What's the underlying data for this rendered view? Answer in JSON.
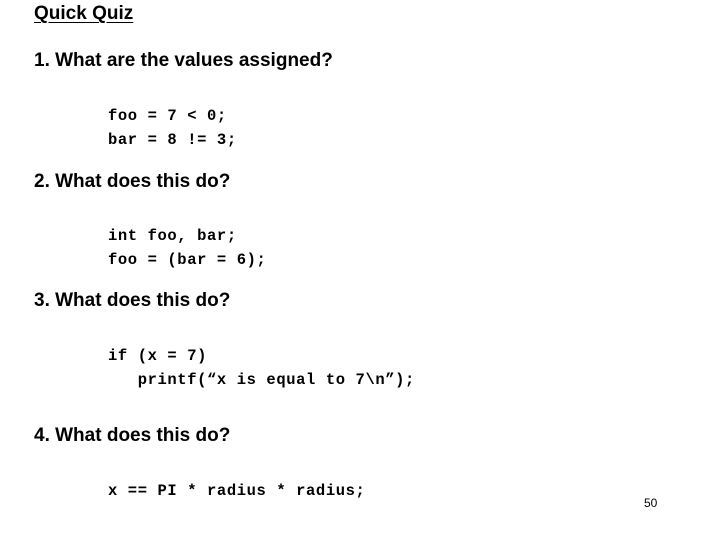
{
  "slide": {
    "title": "Quick Quiz",
    "page_number": "50",
    "background_color": "#ffffff",
    "text_color": "#000000"
  },
  "questions": [
    {
      "heading": "1. What are the values assigned?",
      "code": "foo = 7 < 0;\nbar = 8 != 3;"
    },
    {
      "heading": "2. What does this do?",
      "code": "int foo, bar;\nfoo = (bar = 6);"
    },
    {
      "heading": "3. What does this do?",
      "code": "if (x = 7)\n   printf(“x is equal to 7\\n”);"
    },
    {
      "heading": "4. What does this do?",
      "code": "x == PI * radius * radius;"
    }
  ]
}
